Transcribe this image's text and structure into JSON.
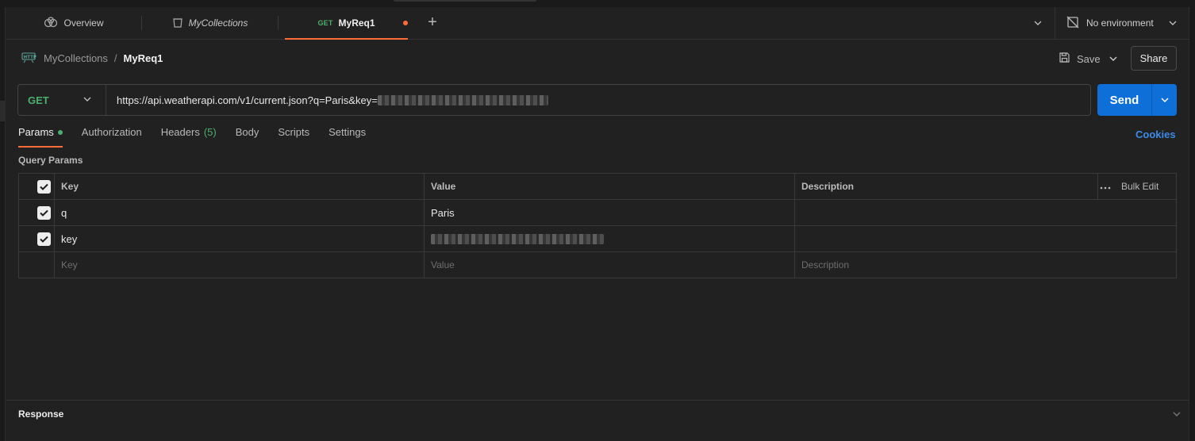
{
  "tabs": [
    {
      "label": "Overview",
      "icon": "overview-icon"
    },
    {
      "label": "MyCollections",
      "icon": "collection-icon"
    },
    {
      "method": "GET",
      "label": "MyReq1",
      "unsaved": true
    }
  ],
  "environment": {
    "label": "No environment",
    "icon": "no-environment-icon"
  },
  "breadcrumb": {
    "collection": "MyCollections",
    "separator": "/",
    "request": "MyReq1",
    "icon": "http-icon"
  },
  "actions": {
    "save": "Save",
    "share": "Share"
  },
  "request": {
    "method": "GET",
    "url_visible": "https://api.weatherapi.com/v1/current.json?q=Paris&key=",
    "send": "Send"
  },
  "request_tabs": [
    {
      "label": "Params",
      "active": true,
      "indicator": true
    },
    {
      "label": "Authorization"
    },
    {
      "label": "Headers",
      "count": "(5)"
    },
    {
      "label": "Body"
    },
    {
      "label": "Scripts"
    },
    {
      "label": "Settings"
    }
  ],
  "cookies": "Cookies",
  "query_params": {
    "title": "Query Params",
    "headers": {
      "key": "Key",
      "value": "Value",
      "description": "Description",
      "bulk_edit": "Bulk Edit"
    },
    "rows": [
      {
        "checked": true,
        "key": "q",
        "value": "Paris",
        "description": ""
      },
      {
        "checked": true,
        "key": "key",
        "value_redacted": true,
        "description": ""
      }
    ],
    "placeholders": {
      "key": "Key",
      "value": "Value",
      "description": "Description"
    }
  },
  "response": {
    "title": "Response"
  },
  "colors": {
    "accent": "#ff6c37",
    "send": "#0f6fd8",
    "method_get": "#4caf6e",
    "link": "#3b8be6"
  }
}
